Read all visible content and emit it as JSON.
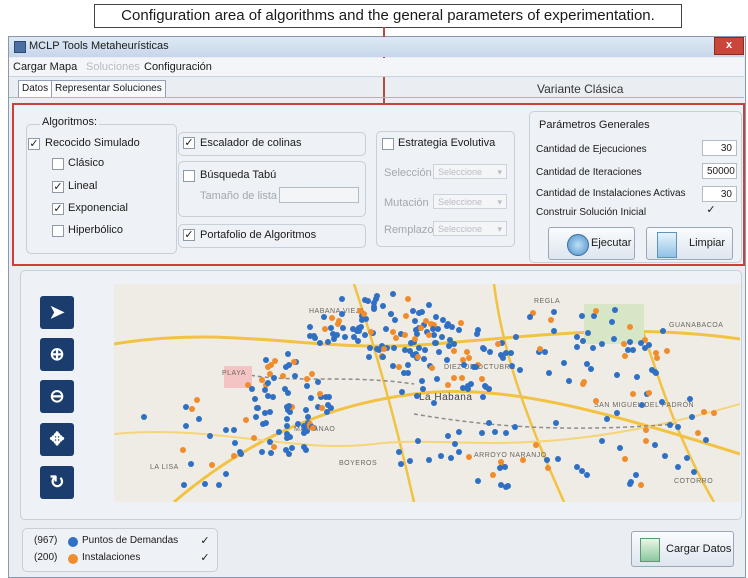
{
  "caption": "Configuration area of algorithms and the general parameters of experimentation.",
  "window": {
    "title": "MCLP Tools Metaheurísticas",
    "close_label": "x"
  },
  "menu": {
    "items": [
      "Cargar Mapa",
      "Soluciones",
      "Configuración"
    ]
  },
  "tabs": [
    {
      "label": "Datos",
      "active": true
    },
    {
      "label": "Representar Soluciones",
      "active": false
    }
  ],
  "variant_label": "Variante Clásica",
  "algorithms": {
    "title": "Algoritmos:",
    "recocido": {
      "label": "Recocido Simulado",
      "checked": true,
      "options": [
        {
          "label": "Clásico",
          "checked": false
        },
        {
          "label": "Lineal",
          "checked": true
        },
        {
          "label": "Exponencial",
          "checked": true
        },
        {
          "label": "Hiperbólico",
          "checked": false
        }
      ]
    },
    "escalador": {
      "label": "Escalador de colinas",
      "checked": true
    },
    "tabu": {
      "label": "Búsqueda Tabú",
      "checked": false,
      "list_size_label": "Tamaño de lista :",
      "list_size_value": ""
    },
    "portafolio": {
      "label": "Portafolio de Algoritmos",
      "checked": true
    },
    "evolutiva": {
      "label": "Estrategia Evolutiva",
      "checked": false,
      "fields": [
        {
          "label": "Selección",
          "value": "Seleccione"
        },
        {
          "label": "Mutación",
          "value": "Seleccione"
        },
        {
          "label": "Remplazo",
          "value": "Seleccione"
        }
      ]
    }
  },
  "general_params": {
    "title": "Parámetros Generales",
    "ejecuciones_label": "Cantidad de Ejecuciones",
    "ejecuciones_value": "30",
    "iteraciones_label": "Cantidad de Iteraciones",
    "iteraciones_value": "50000",
    "instalaciones_label": "Cantidad de Instalaciones Activas",
    "instalaciones_value": "30",
    "construir_label": "Construir Solución Inicial",
    "construir_checked": true,
    "run_button": "Ejecutar",
    "clear_button": "Limpiar"
  },
  "map": {
    "labels": [
      "REGLA",
      "GUANABACOA",
      "DIEZ DE OCTUBRE",
      "La Habana",
      "SAN MIGUEL DEL PADRÓN",
      "MARIANAO",
      "BOYEROS",
      "ARROYO NARANJO",
      "COTORRO",
      "LA LISA",
      "PLAYA",
      "HABANA VIEJA"
    ],
    "tools": [
      "select-arrow",
      "zoom-in",
      "zoom-out",
      "pan",
      "refresh"
    ]
  },
  "legend": {
    "demandas_count": "(967)",
    "demandas_label": "Puntos de Demandas",
    "demandas_checked": true,
    "instalaciones_count": "(200)",
    "instalaciones_label": "Instalaciones",
    "instalaciones_checked": true
  },
  "colors": {
    "demand": "#2f6fc4",
    "facility": "#f08c2c",
    "accent_border": "#c9413a"
  },
  "load_button": "Cargar Datos"
}
